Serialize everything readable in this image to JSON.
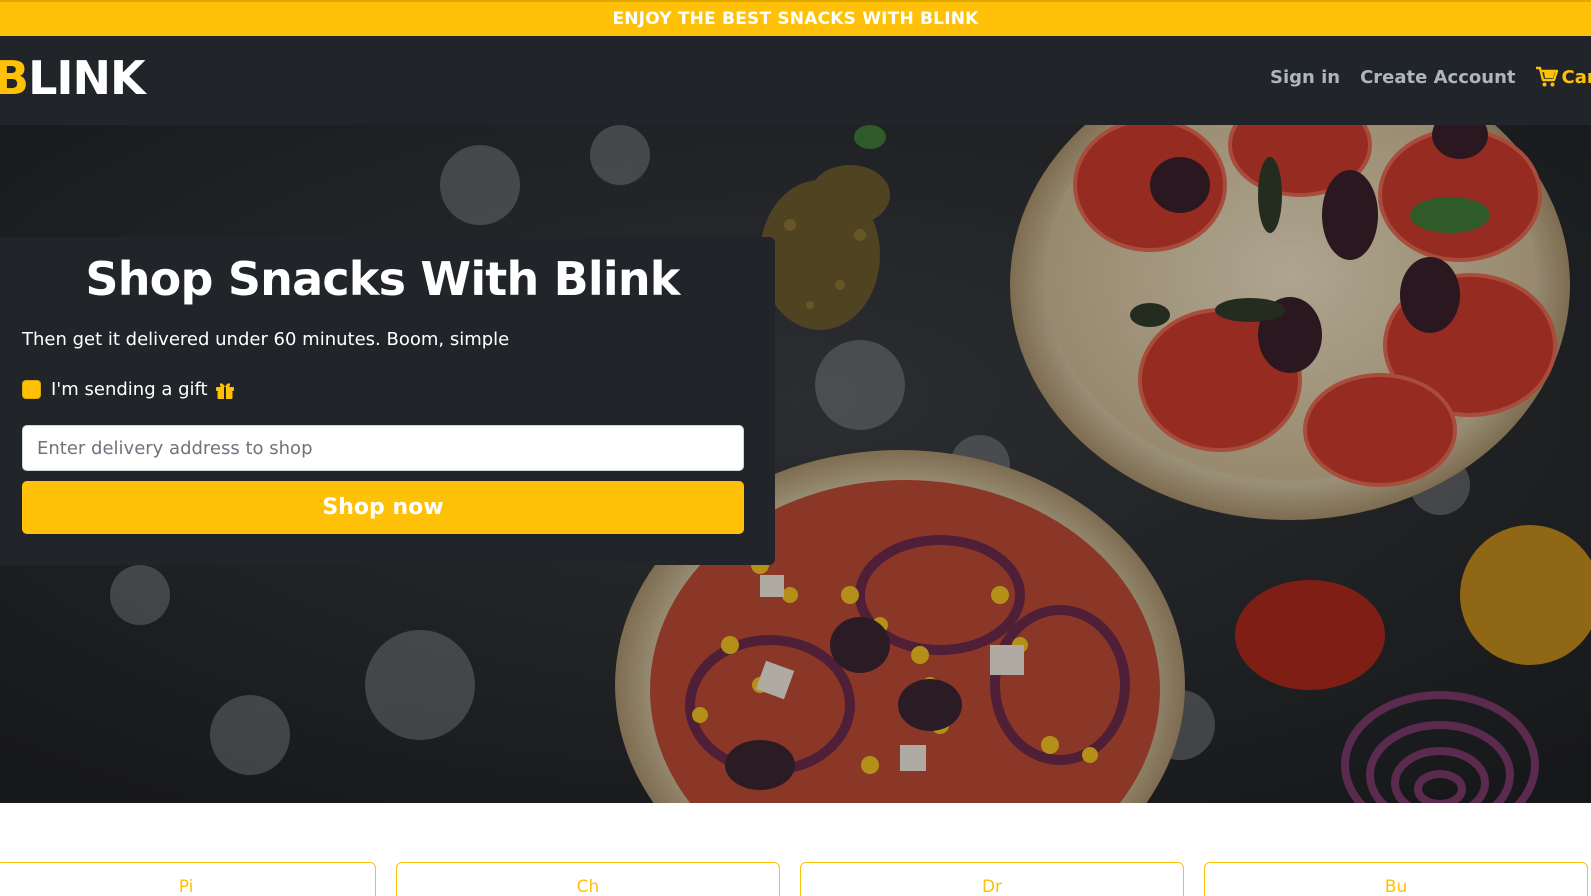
{
  "promo": {
    "text": "ENJOY THE BEST SNACKS WITH BLINK"
  },
  "brand": {
    "first_letter": "B",
    "rest": "LINK"
  },
  "nav": {
    "sign_in": "Sign in",
    "create_account": "Create Account",
    "cart_label": "Cart",
    "cart_icon": "cart-icon"
  },
  "hero": {
    "title": "Shop Snacks With Blink",
    "subtitle": "Then get it delivered under 60 minutes. Boom, simple",
    "gift_label": "I'm sending a gift",
    "gift_checked": true,
    "gift_icon": "gift-icon",
    "address_placeholder": "Enter delivery address to shop",
    "address_value": "",
    "shop_button": "Shop now",
    "background_image": "pizza-photo"
  },
  "categories": [
    {
      "label": "Pi"
    },
    {
      "label": "Ch"
    },
    {
      "label": "Dr"
    },
    {
      "label": "Bu"
    }
  ],
  "colors": {
    "accent": "#ffc107",
    "dark": "#212529",
    "muted_link": "#adb5bd"
  }
}
